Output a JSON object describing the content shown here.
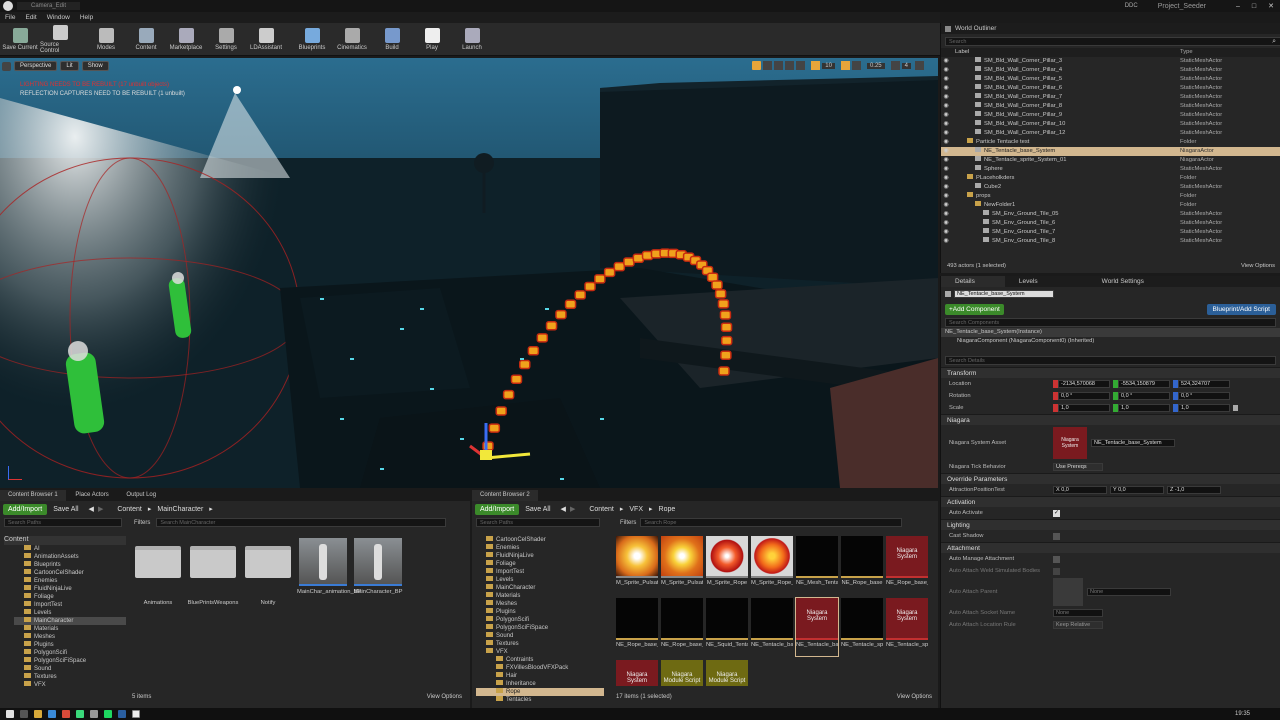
{
  "window": {
    "title": "Camera_Edit",
    "project": "Project_Seeder",
    "ddc": "DDC"
  },
  "menu": [
    "File",
    "Edit",
    "Window",
    "Help"
  ],
  "toolbar": [
    "Save Current",
    "Source Control",
    "Modes",
    "Content",
    "Marketplace",
    "Settings",
    "LDAssistant",
    "Blueprints",
    "Cinematics",
    "Build",
    "Play",
    "Launch"
  ],
  "viewport": {
    "perspective": "Perspective",
    "lit": "Lit",
    "show": "Show",
    "warning1": "LIGHTING NEEDS TO BE REBUILT (17 unbuilt objects)",
    "warning2": "REFLECTION CAPTURES NEED TO BE REBUILT (1 unbuilt)",
    "snap_angle": "10",
    "fov": "0.25",
    "grid": "4"
  },
  "outliner": {
    "tab": "World Outliner",
    "search": "Search",
    "col_label": "Label",
    "col_type": "Type",
    "rows": [
      {
        "label": "SM_Bld_Wall_Corner_Pillar_3",
        "type": "StaticMeshActor",
        "indent": 3
      },
      {
        "label": "SM_Bld_Wall_Corner_Pillar_4",
        "type": "StaticMeshActor",
        "indent": 3
      },
      {
        "label": "SM_Bld_Wall_Corner_Pillar_5",
        "type": "StaticMeshActor",
        "indent": 3
      },
      {
        "label": "SM_Bld_Wall_Corner_Pillar_6",
        "type": "StaticMeshActor",
        "indent": 3
      },
      {
        "label": "SM_Bld_Wall_Corner_Pillar_7",
        "type": "StaticMeshActor",
        "indent": 3
      },
      {
        "label": "SM_Bld_Wall_Corner_Pillar_8",
        "type": "StaticMeshActor",
        "indent": 3
      },
      {
        "label": "SM_Bld_Wall_Corner_Pillar_9",
        "type": "StaticMeshActor",
        "indent": 3
      },
      {
        "label": "SM_Bld_Wall_Corner_Pillar_10",
        "type": "StaticMeshActor",
        "indent": 3
      },
      {
        "label": "SM_Bld_Wall_Corner_Pillar_12",
        "type": "StaticMeshActor",
        "indent": 3
      },
      {
        "label": "Particle Tentacle test",
        "type": "Folder",
        "indent": 2
      },
      {
        "label": "NE_Tentacle_base_System",
        "type": "NiagaraActor",
        "indent": 3,
        "selected": true
      },
      {
        "label": "NE_Tentacle_sprite_System_01",
        "type": "NiagaraActor",
        "indent": 3
      },
      {
        "label": "Sphere",
        "type": "StaticMeshActor",
        "indent": 3
      },
      {
        "label": "PLaceholkders",
        "type": "Folder",
        "indent": 2
      },
      {
        "label": "Cube2",
        "type": "StaticMeshActor",
        "indent": 3
      },
      {
        "label": "props",
        "type": "Folder",
        "indent": 2
      },
      {
        "label": "NewFolder1",
        "type": "Folder",
        "indent": 3
      },
      {
        "label": "SM_Env_Ground_Tile_05",
        "type": "StaticMeshActor",
        "indent": 4
      },
      {
        "label": "SM_Env_Ground_Tile_6",
        "type": "StaticMeshActor",
        "indent": 4
      },
      {
        "label": "SM_Env_Ground_Tile_7",
        "type": "StaticMeshActor",
        "indent": 4
      },
      {
        "label": "SM_Env_Ground_Tile_8",
        "type": "StaticMeshActor",
        "indent": 4
      }
    ],
    "count": "493 actors (1 selected)",
    "view_options": "View Options"
  },
  "details": {
    "tabs": [
      "Details",
      "Levels",
      "World Settings"
    ],
    "actor_name": "NE_Tentacle_base_System",
    "add_component": "+Add Component",
    "blueprint_script": "Blueprint/Add Script",
    "search_components": "Search Components",
    "instance": "NE_Tentacle_base_System(Instance)",
    "component": "NiagaraComponent (NiagaraComponent0) (Inherited)",
    "search_details": "Search Details",
    "transform": {
      "title": "Transform",
      "location_label": "Location",
      "location": [
        "-2134,570068",
        "-5534,150879",
        "524,324707"
      ],
      "rotation_label": "Rotation",
      "rotation": [
        "0,0 °",
        "0,0 °",
        "0,0 °"
      ],
      "scale_label": "Scale",
      "scale": [
        "1,0",
        "1,0",
        "1,0"
      ]
    },
    "niagara": {
      "title": "Niagara",
      "asset_label": "Niagara System Asset",
      "asset": "NE_Tentacle_base_System",
      "thumb": "Niagara System",
      "tick_label": "Niagara Tick Behavior",
      "tick": "Use Prereqs"
    },
    "override": {
      "title": "Override Parameters",
      "param": "AttractionPositionTest",
      "values": [
        "X 0,0",
        "Y 0,0",
        "Z -1,0"
      ]
    },
    "activation": {
      "title": "Activation",
      "auto_activate": "Auto Activate"
    },
    "lighting": {
      "title": "Lighting",
      "cast_shadow": "Cast Shadow"
    },
    "attachment": {
      "title": "Attachment",
      "auto_manage": "Auto Manage Attachment",
      "weld": "Auto Attach Weld Simulated Bodies",
      "parent": "Auto Attach Parent",
      "parent_value": "None",
      "socket": "Auto Attach Socket Name",
      "socket_value": "None",
      "location_rule": "Auto Attach Location Rule",
      "location_rule_value": "Keep Relative"
    }
  },
  "cb1": {
    "tabs": [
      "Content Browser 1",
      "Place Actors",
      "Output Log"
    ],
    "add_import": "Add/Import",
    "save_all": "Save All",
    "path": [
      "Content",
      "MainCharacter"
    ],
    "search_paths": "Search Paths",
    "filters": "Filters",
    "search": "Search MainCharacter",
    "tree_root": "Content",
    "tree": [
      "AI",
      "AnimationAssets",
      "Blueprints",
      "CartoonCelShader",
      "Enemies",
      "FluidNinjaLive",
      "Foliage",
      "ImportTest",
      "Levels",
      "MainCharacter",
      "Materials",
      "Meshes",
      "Plugins",
      "PolygonScifi",
      "PolygonSciFiSpace",
      "Sound",
      "Textures",
      "VFX"
    ],
    "assets": [
      "Animations",
      "BluePrintsWeapons",
      "Notify",
      "MainChar_animation_BP",
      "MainCharacter_BP"
    ],
    "count": "5 items",
    "view_options": "View Options"
  },
  "cb2": {
    "tab": "Content Browser 2",
    "add_import": "Add/Import",
    "save_all": "Save All",
    "path": [
      "Content",
      "VFX",
      "Rope"
    ],
    "search_paths": "Search Paths",
    "filters": "Filters",
    "search": "Search Rope",
    "tree": [
      "CartoonCelShader",
      "Enemies",
      "FluidNinjaLive",
      "Foliage",
      "ImportTest",
      "Levels",
      "MainCharacter",
      "Materials",
      "Meshes",
      "Plugins",
      "PolygonScifi",
      "PolygonSciFiSpace",
      "Sound",
      "Textures",
      "VFX",
      "Contraints",
      "FXVillesBloodVFXPack",
      "Hair",
      "Inheritance",
      "Rope",
      "Tentacles"
    ],
    "assets": [
      {
        "name": "M_Sprite_Pulsating",
        "kind": "fire"
      },
      {
        "name": "M_Sprite_Pulsating_Inst",
        "kind": "fire2"
      },
      {
        "name": "M_Sprite_Rope",
        "kind": "ball"
      },
      {
        "name": "M_Sprite_Rope_Inst",
        "kind": "ball2"
      },
      {
        "name": "NE_Mesh_Tentacle",
        "kind": "black"
      },
      {
        "name": "NE_Rope_base",
        "kind": "black"
      },
      {
        "name": "NE_Rope_base_System",
        "kind": "sys",
        "label": "Niagara System"
      },
      {
        "name": "NE_Rope_base_Test_01",
        "kind": "black"
      },
      {
        "name": "NE_Rope_base_Test_02",
        "kind": "black"
      },
      {
        "name": "NE_Squid_Tentacle_25jan",
        "kind": "black"
      },
      {
        "name": "NE_Tentacle_base",
        "kind": "black"
      },
      {
        "name": "NE_Tentacle_base_System",
        "kind": "sys",
        "label": "Niagara System"
      },
      {
        "name": "NE_Tentacle_sprite",
        "kind": "black"
      },
      {
        "name": "NE_Tentacle_sprite_System",
        "kind": "sys",
        "label": "Niagara System"
      },
      {
        "name": "",
        "kind": "sys",
        "label": "Niagara System"
      },
      {
        "name": "",
        "kind": "mod",
        "label": "Niagara Module Script"
      },
      {
        "name": "",
        "kind": "mod",
        "label": "Niagara Module Script"
      }
    ],
    "count": "17 items (1 selected)",
    "view_options": "View Options"
  },
  "taskbar": {
    "time": "19:35"
  }
}
